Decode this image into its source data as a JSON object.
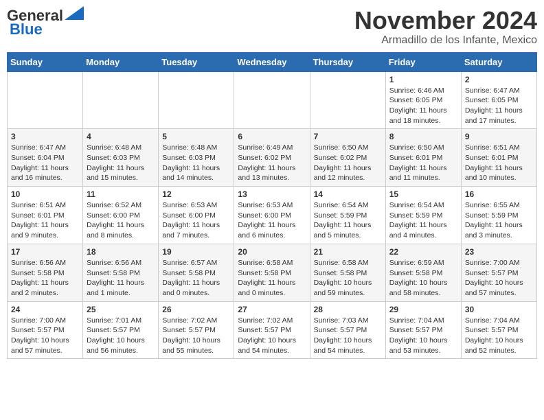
{
  "header": {
    "logo_general": "General",
    "logo_blue": "Blue",
    "month_title": "November 2024",
    "location": "Armadillo de los Infante, Mexico"
  },
  "weekdays": [
    "Sunday",
    "Monday",
    "Tuesday",
    "Wednesday",
    "Thursday",
    "Friday",
    "Saturday"
  ],
  "weeks": [
    [
      {
        "day": "",
        "info": ""
      },
      {
        "day": "",
        "info": ""
      },
      {
        "day": "",
        "info": ""
      },
      {
        "day": "",
        "info": ""
      },
      {
        "day": "",
        "info": ""
      },
      {
        "day": "1",
        "info": "Sunrise: 6:46 AM\nSunset: 6:05 PM\nDaylight: 11 hours and 18 minutes."
      },
      {
        "day": "2",
        "info": "Sunrise: 6:47 AM\nSunset: 6:05 PM\nDaylight: 11 hours and 17 minutes."
      }
    ],
    [
      {
        "day": "3",
        "info": "Sunrise: 6:47 AM\nSunset: 6:04 PM\nDaylight: 11 hours and 16 minutes."
      },
      {
        "day": "4",
        "info": "Sunrise: 6:48 AM\nSunset: 6:03 PM\nDaylight: 11 hours and 15 minutes."
      },
      {
        "day": "5",
        "info": "Sunrise: 6:48 AM\nSunset: 6:03 PM\nDaylight: 11 hours and 14 minutes."
      },
      {
        "day": "6",
        "info": "Sunrise: 6:49 AM\nSunset: 6:02 PM\nDaylight: 11 hours and 13 minutes."
      },
      {
        "day": "7",
        "info": "Sunrise: 6:50 AM\nSunset: 6:02 PM\nDaylight: 11 hours and 12 minutes."
      },
      {
        "day": "8",
        "info": "Sunrise: 6:50 AM\nSunset: 6:01 PM\nDaylight: 11 hours and 11 minutes."
      },
      {
        "day": "9",
        "info": "Sunrise: 6:51 AM\nSunset: 6:01 PM\nDaylight: 11 hours and 10 minutes."
      }
    ],
    [
      {
        "day": "10",
        "info": "Sunrise: 6:51 AM\nSunset: 6:01 PM\nDaylight: 11 hours and 9 minutes."
      },
      {
        "day": "11",
        "info": "Sunrise: 6:52 AM\nSunset: 6:00 PM\nDaylight: 11 hours and 8 minutes."
      },
      {
        "day": "12",
        "info": "Sunrise: 6:53 AM\nSunset: 6:00 PM\nDaylight: 11 hours and 7 minutes."
      },
      {
        "day": "13",
        "info": "Sunrise: 6:53 AM\nSunset: 6:00 PM\nDaylight: 11 hours and 6 minutes."
      },
      {
        "day": "14",
        "info": "Sunrise: 6:54 AM\nSunset: 5:59 PM\nDaylight: 11 hours and 5 minutes."
      },
      {
        "day": "15",
        "info": "Sunrise: 6:54 AM\nSunset: 5:59 PM\nDaylight: 11 hours and 4 minutes."
      },
      {
        "day": "16",
        "info": "Sunrise: 6:55 AM\nSunset: 5:59 PM\nDaylight: 11 hours and 3 minutes."
      }
    ],
    [
      {
        "day": "17",
        "info": "Sunrise: 6:56 AM\nSunset: 5:58 PM\nDaylight: 11 hours and 2 minutes."
      },
      {
        "day": "18",
        "info": "Sunrise: 6:56 AM\nSunset: 5:58 PM\nDaylight: 11 hours and 1 minute."
      },
      {
        "day": "19",
        "info": "Sunrise: 6:57 AM\nSunset: 5:58 PM\nDaylight: 11 hours and 0 minutes."
      },
      {
        "day": "20",
        "info": "Sunrise: 6:58 AM\nSunset: 5:58 PM\nDaylight: 11 hours and 0 minutes."
      },
      {
        "day": "21",
        "info": "Sunrise: 6:58 AM\nSunset: 5:58 PM\nDaylight: 10 hours and 59 minutes."
      },
      {
        "day": "22",
        "info": "Sunrise: 6:59 AM\nSunset: 5:58 PM\nDaylight: 10 hours and 58 minutes."
      },
      {
        "day": "23",
        "info": "Sunrise: 7:00 AM\nSunset: 5:57 PM\nDaylight: 10 hours and 57 minutes."
      }
    ],
    [
      {
        "day": "24",
        "info": "Sunrise: 7:00 AM\nSunset: 5:57 PM\nDaylight: 10 hours and 57 minutes."
      },
      {
        "day": "25",
        "info": "Sunrise: 7:01 AM\nSunset: 5:57 PM\nDaylight: 10 hours and 56 minutes."
      },
      {
        "day": "26",
        "info": "Sunrise: 7:02 AM\nSunset: 5:57 PM\nDaylight: 10 hours and 55 minutes."
      },
      {
        "day": "27",
        "info": "Sunrise: 7:02 AM\nSunset: 5:57 PM\nDaylight: 10 hours and 54 minutes."
      },
      {
        "day": "28",
        "info": "Sunrise: 7:03 AM\nSunset: 5:57 PM\nDaylight: 10 hours and 54 minutes."
      },
      {
        "day": "29",
        "info": "Sunrise: 7:04 AM\nSunset: 5:57 PM\nDaylight: 10 hours and 53 minutes."
      },
      {
        "day": "30",
        "info": "Sunrise: 7:04 AM\nSunset: 5:57 PM\nDaylight: 10 hours and 52 minutes."
      }
    ]
  ]
}
